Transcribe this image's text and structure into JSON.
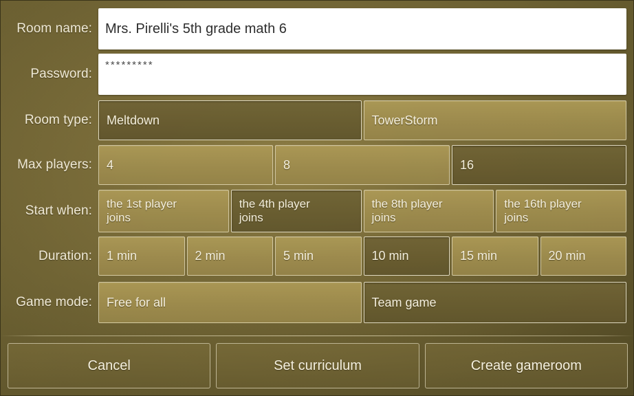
{
  "form": {
    "room_name": {
      "label": "Room name:",
      "value": "Mrs. Pirelli's 5th grade math 6",
      "placeholder": ""
    },
    "password": {
      "label": "Password:",
      "value": "*********",
      "placeholder": ""
    },
    "room_type": {
      "label": "Room type:",
      "options": [
        "Meltdown",
        "TowerStorm"
      ],
      "selected": "Meltdown"
    },
    "max_players": {
      "label": "Max players:",
      "options": [
        "4",
        "8",
        "16"
      ],
      "selected": "16"
    },
    "start_when": {
      "label": "Start when:",
      "options": [
        "the 1st player joins",
        "the 4th player joins",
        "the 8th player joins",
        "the 16th player joins"
      ],
      "selected": "the 4th player joins"
    },
    "duration": {
      "label": "Duration:",
      "options": [
        "1 min",
        "2 min",
        "5 min",
        "10 min",
        "15 min",
        "20 min"
      ],
      "selected": "10 min"
    },
    "game_mode": {
      "label": "Game mode:",
      "options": [
        "Free for all",
        "Team game"
      ],
      "selected": "Team game"
    }
  },
  "footer": {
    "cancel_label": "Cancel",
    "set_curriculum_label": "Set curriculum",
    "create_gameroom_label": "Create gameroom"
  },
  "colors": {
    "background": "#6a5f31",
    "option_unselected": "#9e8c4e",
    "option_selected": "#685c30",
    "text": "#f4efdd",
    "input_background": "#ffffff",
    "input_text": "#2d2d2d"
  }
}
